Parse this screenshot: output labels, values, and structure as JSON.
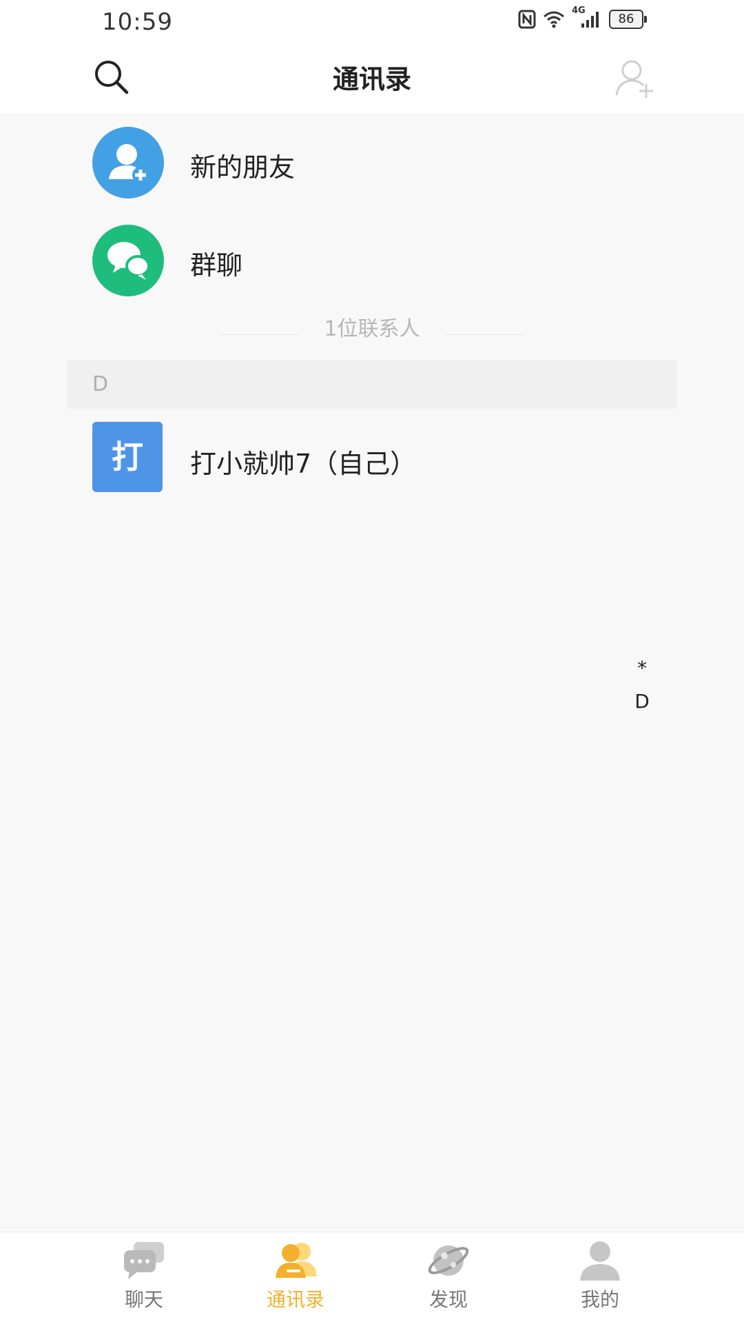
{
  "status_bar": {
    "time": "10:59",
    "battery": "86",
    "network": "4G"
  },
  "header": {
    "title": "通讯录",
    "search_icon": "search-icon",
    "add_friend_icon": "add-user-icon"
  },
  "entries": [
    {
      "label": "新的朋友",
      "icon": "add-user-icon",
      "color": "#42a0e4"
    },
    {
      "label": "群聊",
      "icon": "chat-bubbles-icon",
      "color": "#1ebd7d"
    }
  ],
  "contact_count": "1位联系人",
  "sections": [
    {
      "letter": "D",
      "contacts": [
        {
          "avatar_text": "打",
          "name": "打小就帅7（自己）",
          "avatar_color": "#4e95e8"
        }
      ]
    }
  ],
  "index_bar": [
    "*",
    "D"
  ],
  "bottom_nav": {
    "active": "contacts",
    "items": [
      {
        "key": "chat",
        "label": "聊天",
        "icon": "chat-icon"
      },
      {
        "key": "contacts",
        "label": "通讯录",
        "icon": "contacts-icon"
      },
      {
        "key": "discover",
        "label": "发现",
        "icon": "planet-icon"
      },
      {
        "key": "me",
        "label": "我的",
        "icon": "person-icon"
      }
    ]
  },
  "colors": {
    "accent": "#f0b12c",
    "inactive": "#777777"
  }
}
